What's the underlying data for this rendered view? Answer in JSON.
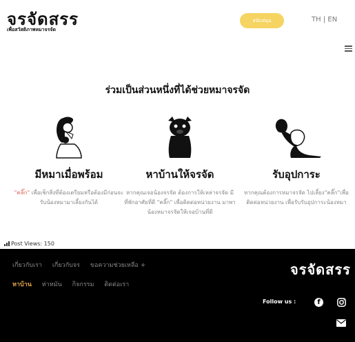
{
  "header": {
    "logo": "จรจัดสรร",
    "tagline": "เพื่อสวัสดิภาพหมาจรจัด",
    "donate_label": "สนับสนุน",
    "lang_th": "TH",
    "lang_sep": "|",
    "lang_en": "EN"
  },
  "main": {
    "headline": "ร่วมเป็นส่วนหนึ่งที่ได้ช่วยหมาจรจัด",
    "columns": [
      {
        "title": "มีหมาเมื่อพร้อม",
        "desc_highlight": "\"คลิ๊ก\"",
        "desc_rest": " เพื่อเช็กสิ่งที่ต้องเตรียมหรือต้องมีก่อนจะรับน้องหมามาเลี้ยงกันได้"
      },
      {
        "title": "หาบ้านให้จรจัด",
        "desc_text": "หากคุณเจอน้องจรจัด ต้องการให้เหล่าจรจัด มีที่พักอาศัยที่ดี \"คลิ๊ก\" เพื่อติดต่อหน่วยงาน มาพาน้องหมาจรจัดให้เจอบ้านที่ดี"
      },
      {
        "title": "รับอุปการะ",
        "desc_text": "หากคุณต้องการหมาจรจัด ไปเลี้ยง\"คลิ๊ก\"เพื่อติดต่อหน่วยงาน เพื่อรับรับอุปการะน้องหมา"
      }
    ]
  },
  "views": {
    "label": "Post Views: 150"
  },
  "footer": {
    "nav_primary": [
      "เกี่ยวกับเรา",
      "เกี่ยวกับจร",
      "ขอความช่วยเหลือ +"
    ],
    "nav_secondary": [
      "หาบ้าน",
      "ห่าหมัน",
      "กิจกรรม",
      "ติดต่อเรา"
    ],
    "logo": "จรจัดสรร",
    "follow_label": "Follow us :",
    "fb_glyph": "f"
  },
  "colors": {
    "donate": "#f6d461",
    "footer_bg": "#000000",
    "active_nav": "#e2a24a",
    "highlight": "#e0695c"
  },
  "icons": [
    "menu-icon",
    "facebook-icon",
    "instagram-icon",
    "mail-icon",
    "bar-chart-icon"
  ]
}
